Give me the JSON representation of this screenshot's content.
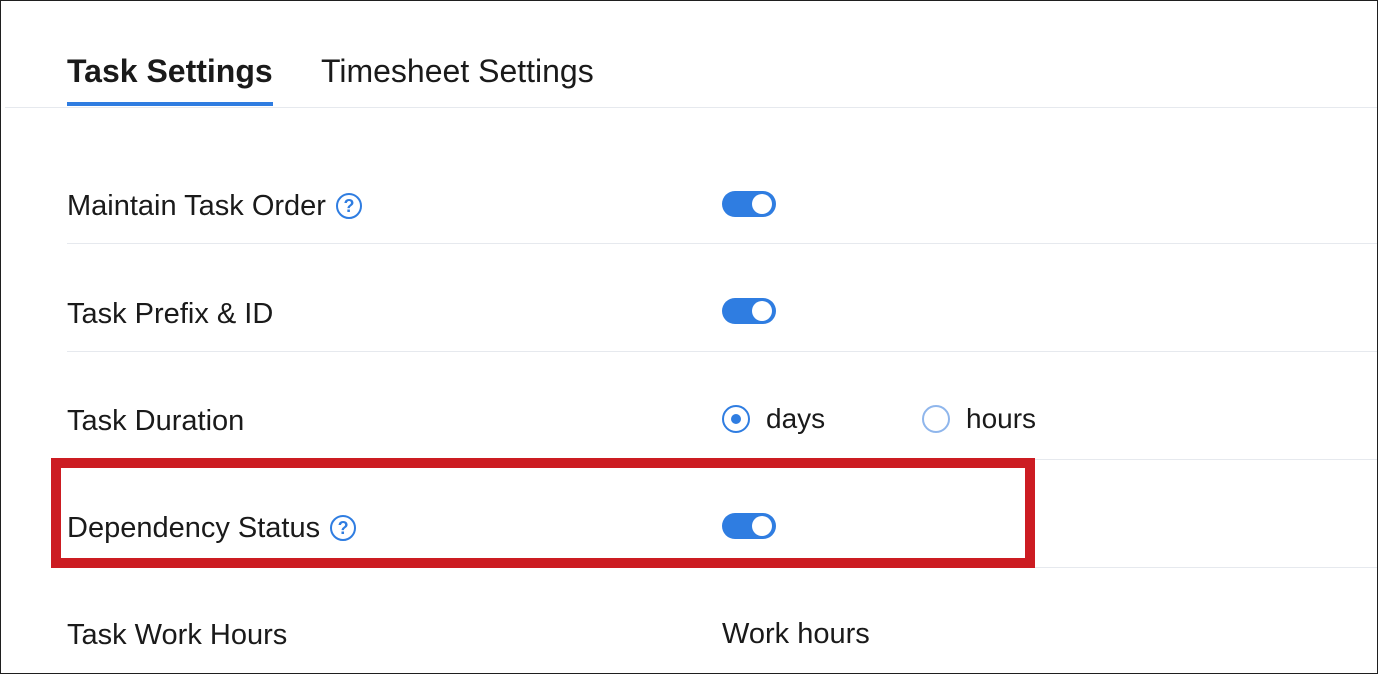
{
  "tabs": [
    {
      "label": "Task Settings",
      "active": true
    },
    {
      "label": "Timesheet Settings",
      "active": false
    }
  ],
  "settings": {
    "maintain_task_order": {
      "label": "Maintain Task Order",
      "help_icon": "question-circle-icon",
      "enabled": true
    },
    "task_prefix": {
      "label": "Task Prefix & ID",
      "enabled": true
    },
    "task_duration": {
      "label": "Task Duration",
      "options": [
        {
          "label": "days",
          "selected": true
        },
        {
          "label": "hours",
          "selected": false
        }
      ]
    },
    "dependency_status": {
      "label": "Dependency Status",
      "help_icon": "question-circle-icon",
      "enabled": true
    },
    "task_work_hours": {
      "label": "Task Work Hours",
      "value": "Work hours"
    }
  },
  "colors": {
    "accent": "#2f7de1",
    "highlight": "#cc1c22"
  }
}
